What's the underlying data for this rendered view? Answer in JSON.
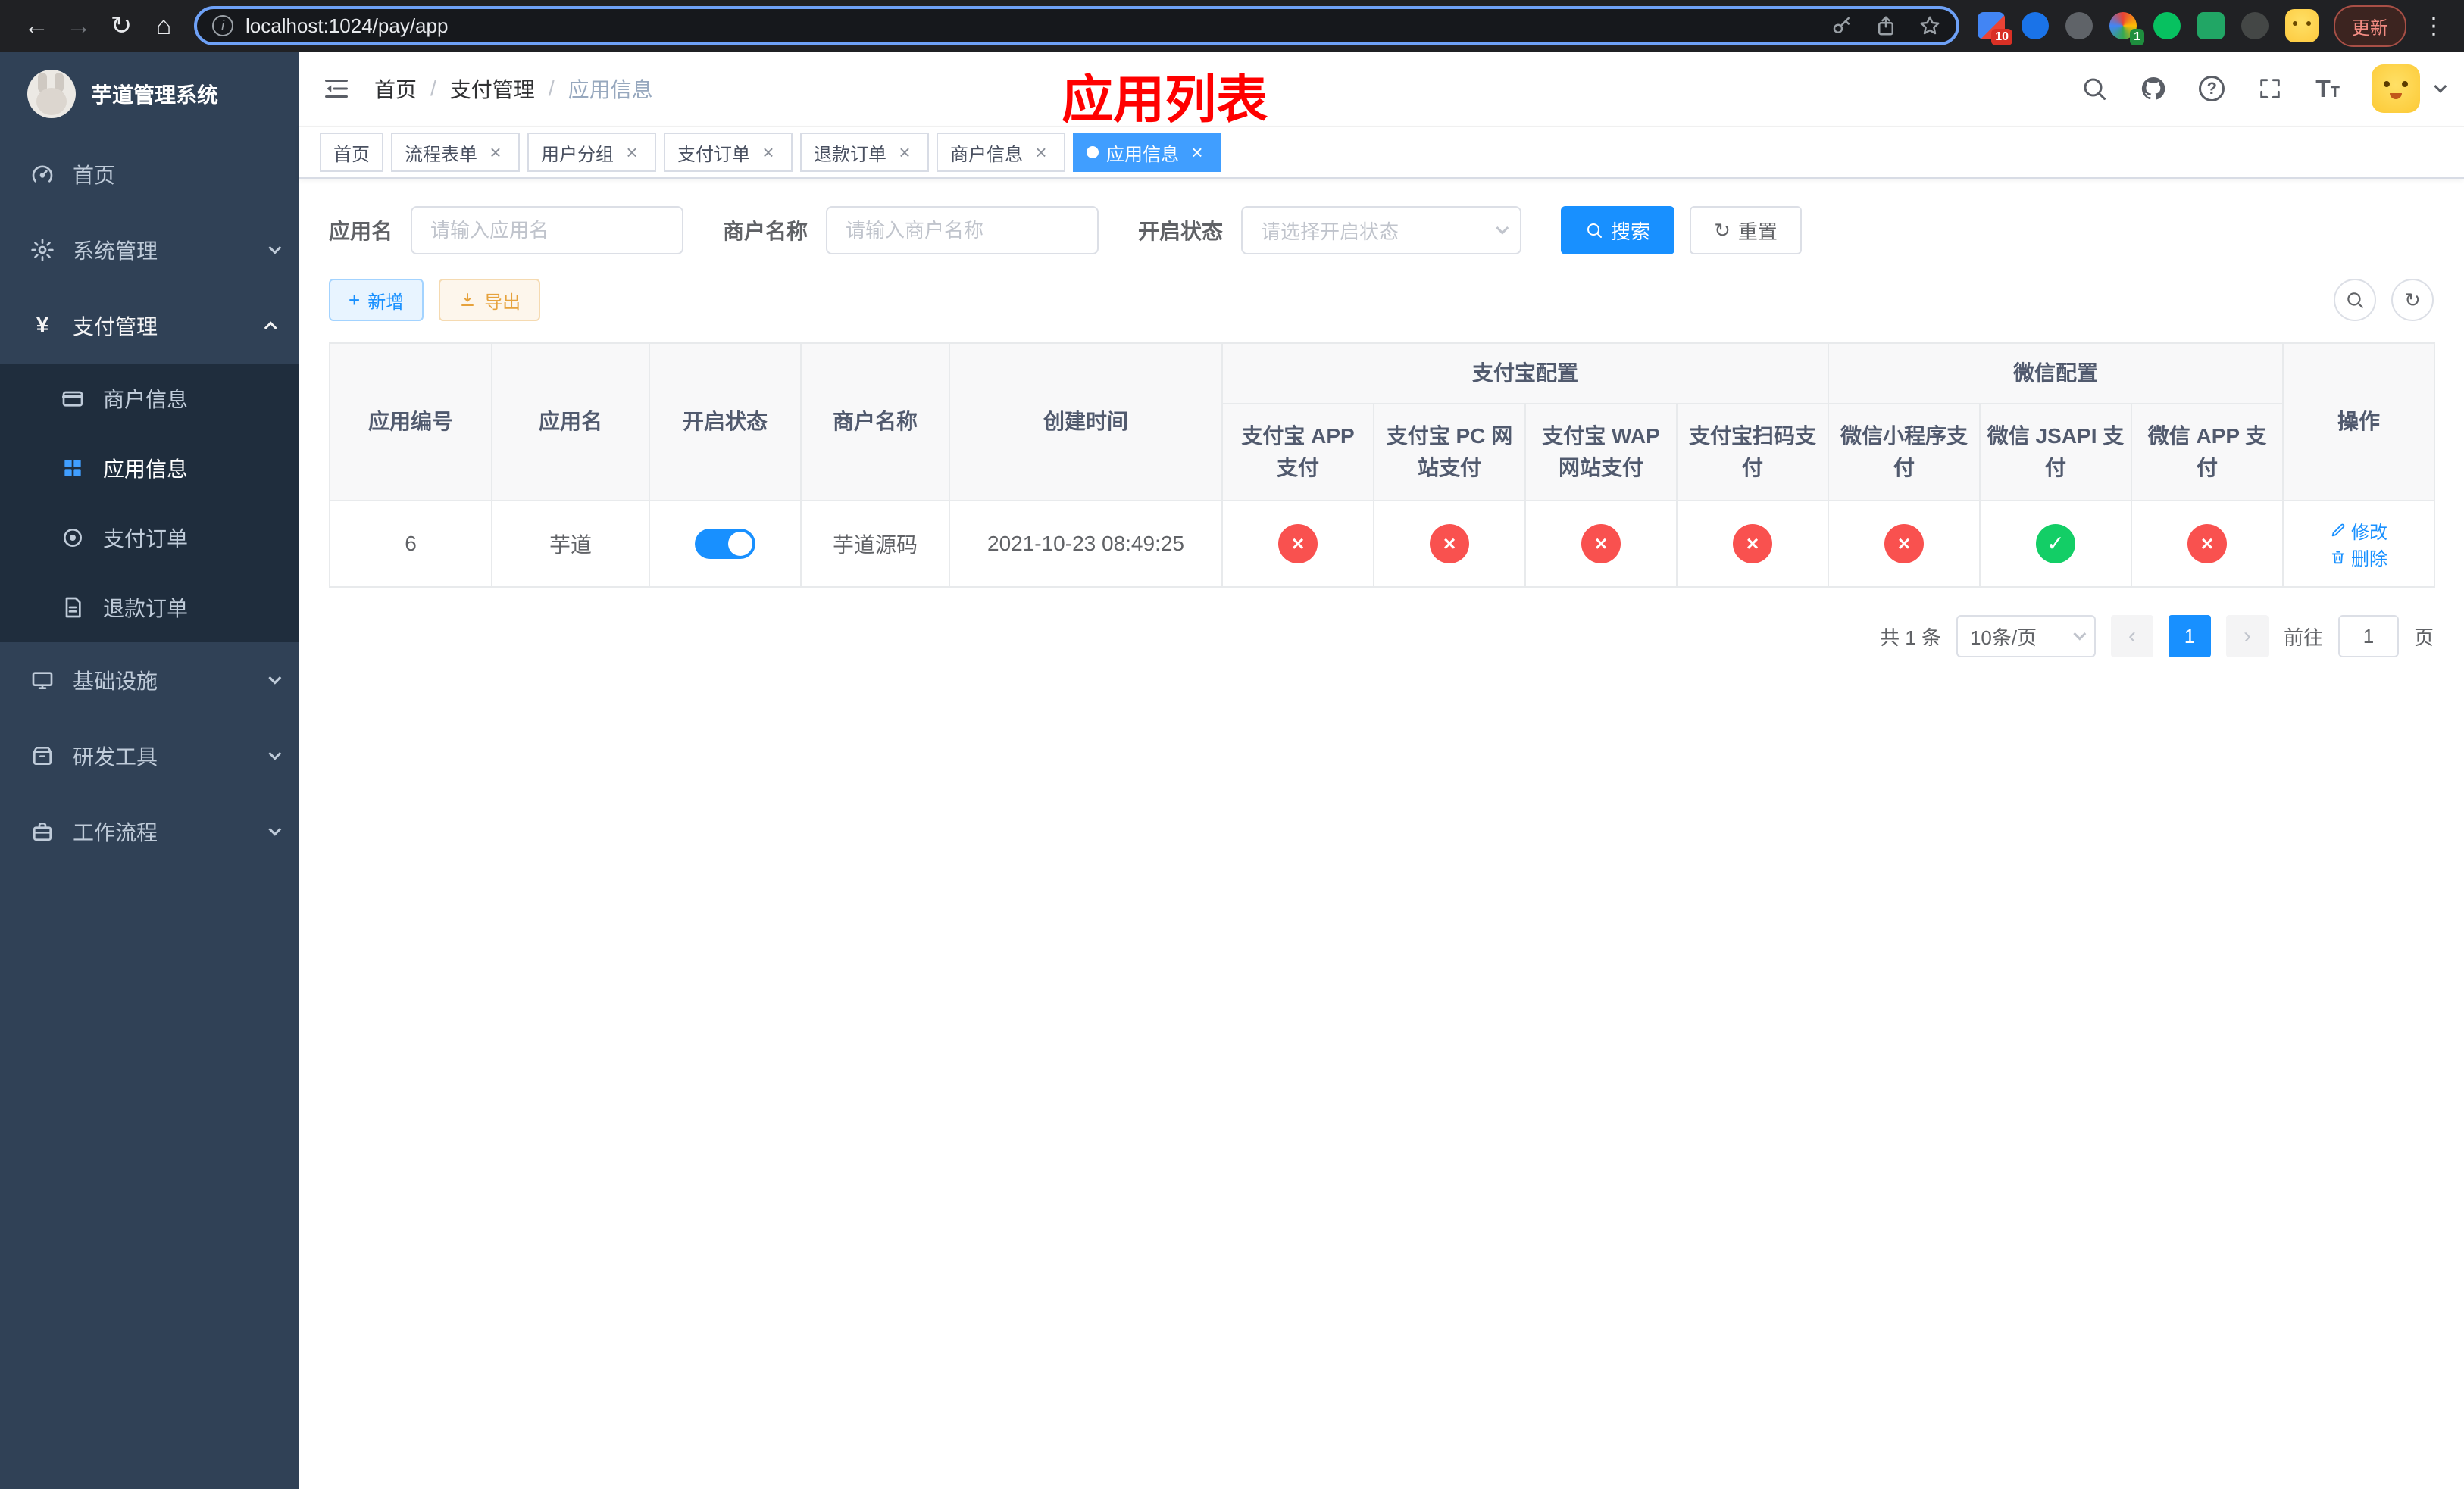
{
  "browser": {
    "url": "localhost:1024/pay/app",
    "update_button_label": "更新",
    "extensions_badge_1": "10",
    "extensions_badge_2": "1"
  },
  "icons": {
    "back": "←",
    "forward": "→",
    "reload": "↻",
    "home": "⌂",
    "info": "i",
    "more": "⋮",
    "close": "×",
    "plus": "+",
    "prev": "‹",
    "next": "›",
    "check": "✓",
    "cross": "×",
    "yuan": "¥",
    "question": "?",
    "text_size_big": "T",
    "text_size_small": "T"
  },
  "sidebar": {
    "app_title": "芋道管理系统",
    "menu": {
      "home": "首页",
      "system": "系统管理",
      "payment": "支付管理",
      "merchant_info": "商户信息",
      "app_info": "应用信息",
      "pay_order": "支付订单",
      "refund_order": "退款订单",
      "infra": "基础设施",
      "dev_tools": "研发工具",
      "workflow": "工作流程"
    }
  },
  "navbar": {
    "breadcrumb": [
      "首页",
      "支付管理",
      "应用信息"
    ],
    "overlay_title": "应用列表"
  },
  "tabs": [
    {
      "label": "首页",
      "closable": false,
      "active": false
    },
    {
      "label": "流程表单",
      "closable": true,
      "active": false
    },
    {
      "label": "用户分组",
      "closable": true,
      "active": false
    },
    {
      "label": "支付订单",
      "closable": true,
      "active": false
    },
    {
      "label": "退款订单",
      "closable": true,
      "active": false
    },
    {
      "label": "商户信息",
      "closable": true,
      "active": false
    },
    {
      "label": "应用信息",
      "closable": true,
      "active": true
    }
  ],
  "filters": {
    "app_name_label": "应用名",
    "app_name_placeholder": "请输入应用名",
    "merchant_label": "商户名称",
    "merchant_placeholder": "请输入商户名称",
    "status_label": "开启状态",
    "status_placeholder": "请选择开启状态",
    "search_button": "搜索",
    "reset_button": "重置"
  },
  "toolbar": {
    "add_button": "新增",
    "export_button": "导出"
  },
  "table": {
    "group_alipay": "支付宝配置",
    "group_wechat": "微信配置",
    "col_app_id": "应用编号",
    "col_app_name": "应用名",
    "col_status": "开启状态",
    "col_merchant": "商户名称",
    "col_created": "创建时间",
    "col_alipay_app": "支付宝 APP 支付",
    "col_alipay_pc": "支付宝 PC 网站支付",
    "col_alipay_wap": "支付宝 WAP 网站支付",
    "col_alipay_qr": "支付宝扫码支付",
    "col_wx_mini": "微信小程序支付",
    "col_wx_jsapi": "微信 JSAPI 支付",
    "col_wx_app": "微信 APP 支付",
    "col_actions": "操作",
    "row": {
      "id": "6",
      "name": "芋道",
      "enabled": true,
      "merchant": "芋道源码",
      "created_at": "2021-10-23 08:49:25",
      "configs": {
        "alipay_app": false,
        "alipay_pc": false,
        "alipay_wap": false,
        "alipay_qr": false,
        "wx_mini": false,
        "wx_jsapi": true,
        "wx_app": false
      },
      "edit_label": "修改",
      "delete_label": "删除"
    }
  },
  "pagination": {
    "total": "共 1 条",
    "page_size": "10条/页",
    "page": "1",
    "goto_prefix": "前往",
    "goto_value": "1",
    "goto_suffix": "页"
  },
  "colors": {
    "primary": "#1890ff",
    "tab_active": "#409eff",
    "danger": "#f9514f",
    "success": "#13ce66",
    "warning": "#e6a23c",
    "sidebar_bg": "#304156",
    "submenu_bg": "#1f2d3d",
    "overlay_title_red": "#ff0000"
  }
}
